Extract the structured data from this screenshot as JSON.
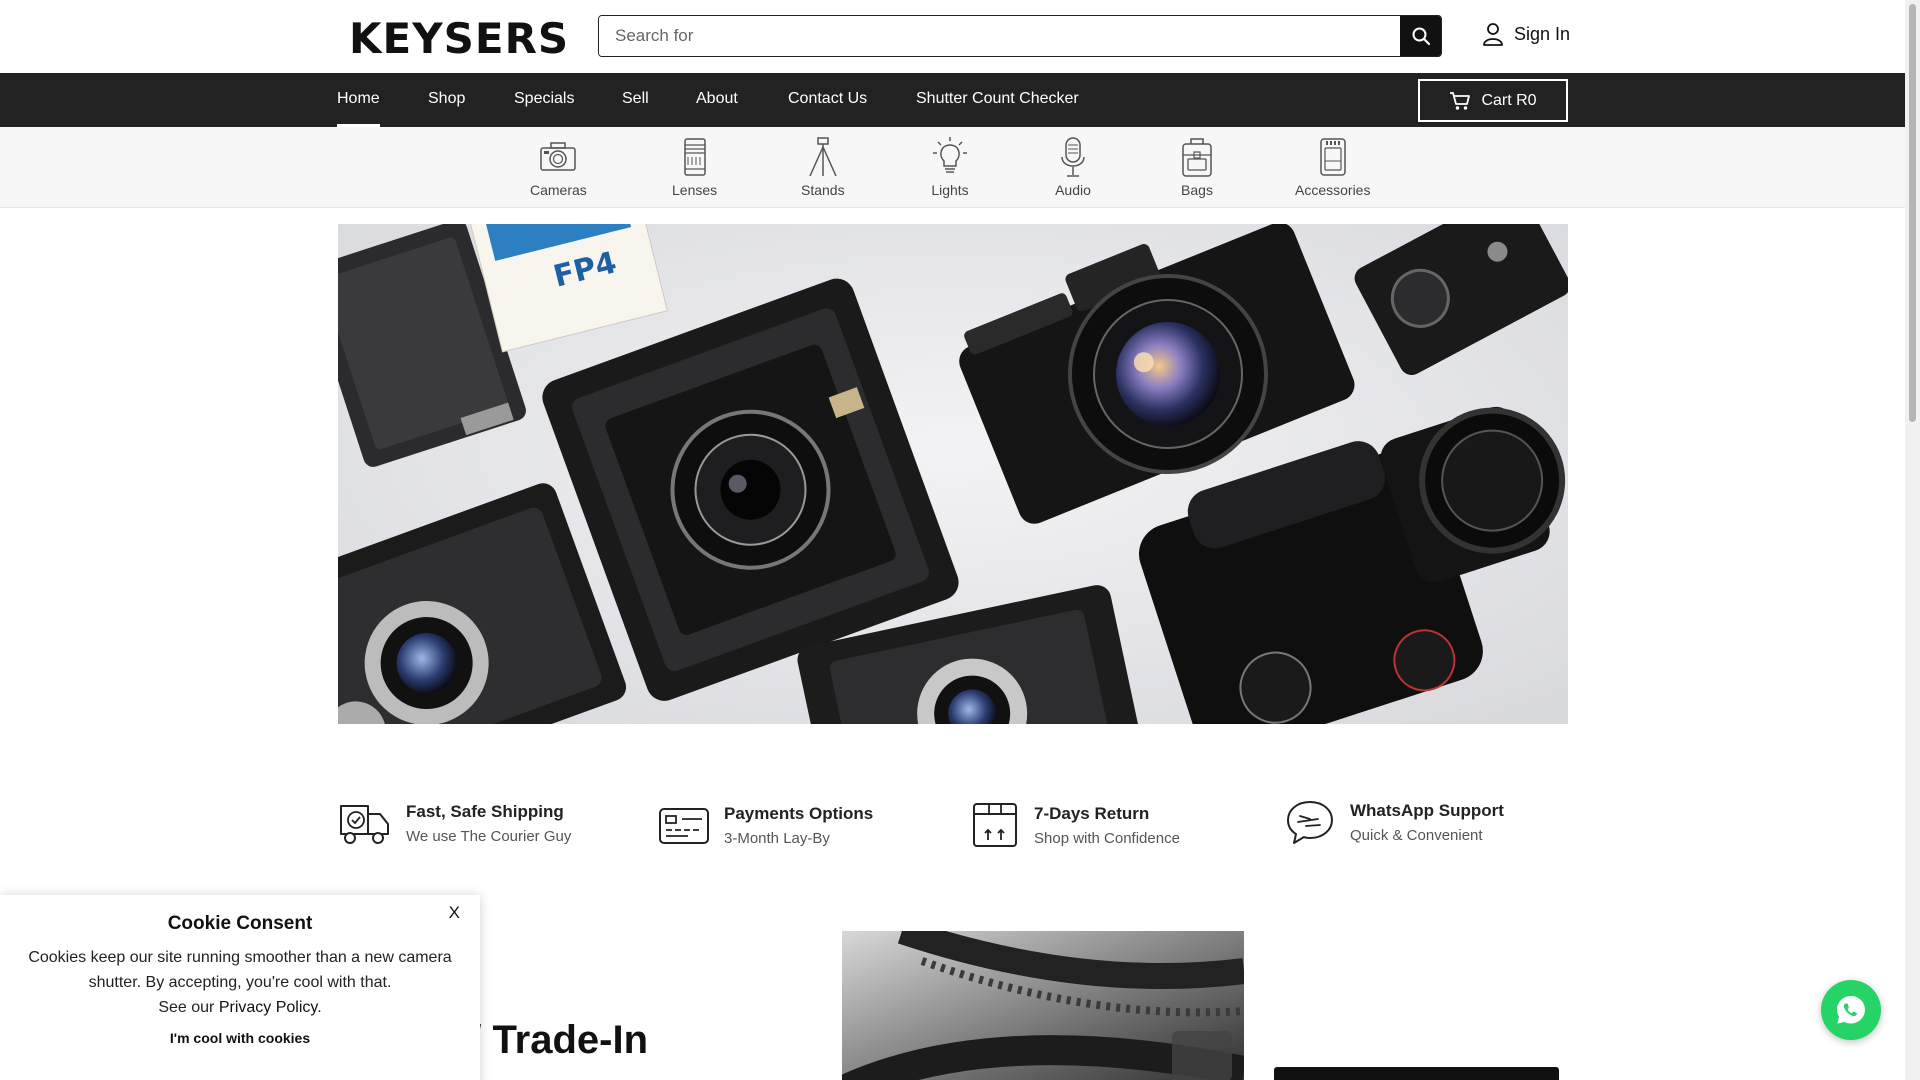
{
  "header": {
    "logo": "KEYSERS",
    "search_placeholder": "Search for",
    "signin_label": "Sign In"
  },
  "nav": {
    "items": [
      {
        "label": "Home",
        "active": true
      },
      {
        "label": "Shop"
      },
      {
        "label": "Specials"
      },
      {
        "label": "Sell"
      },
      {
        "label": "About"
      },
      {
        "label": "Contact Us"
      },
      {
        "label": "Shutter Count Checker"
      }
    ],
    "cart_label": "Cart R0"
  },
  "categories": [
    {
      "label": "Cameras",
      "icon": "camera-icon"
    },
    {
      "label": "Lenses",
      "icon": "lens-icon"
    },
    {
      "label": "Stands",
      "icon": "tripod-icon"
    },
    {
      "label": "Lights",
      "icon": "lightbulb-icon"
    },
    {
      "label": "Audio",
      "icon": "microphone-icon"
    },
    {
      "label": "Bags",
      "icon": "bag-icon"
    },
    {
      "label": "Accessories",
      "icon": "battery-icon"
    }
  ],
  "features": [
    {
      "title": "Fast, Safe Shipping",
      "subtitle": "We use The Courier Guy",
      "icon": "delivery-truck-icon"
    },
    {
      "title": "Payments Options",
      "subtitle": "3-Month Lay-By",
      "icon": "payment-card-icon"
    },
    {
      "title": "7-Days Return",
      "subtitle": "Shop with Confidence",
      "icon": "return-box-icon"
    },
    {
      "title": "WhatsApp Support",
      "subtitle": "Quick & Convenient",
      "icon": "chat-bubble-icon"
    }
  ],
  "trade": {
    "title_partial": "l / Trade-In"
  },
  "cookie": {
    "close_label": "X",
    "title": "Cookie Consent",
    "text_line1": "Cookies keep our site running smoother than a new camera",
    "text_line2": "shutter. By accepting, you're cool with that.",
    "text_prefix": "See our ",
    "link": "Privacy Policy",
    "text_suffix": ".",
    "accept": "I'm cool with cookies"
  },
  "colors": {
    "nav_bg": "#222222",
    "whatsapp": "#25d366"
  }
}
